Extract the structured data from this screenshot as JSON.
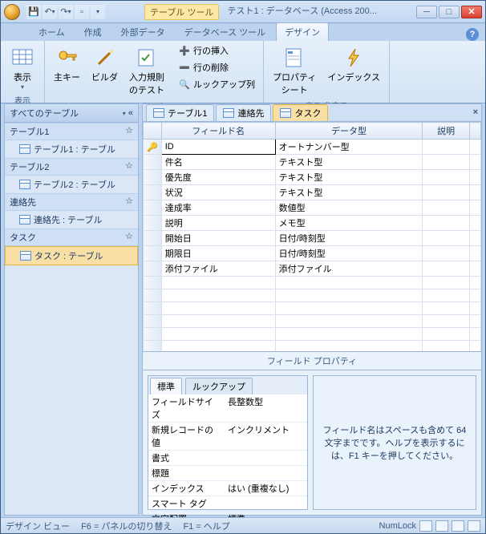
{
  "titlebar": {
    "context_tab": "テーブル ツール",
    "app_title": "テスト1 : データベース (Access 200..."
  },
  "ribbon": {
    "tabs": [
      "ホーム",
      "作成",
      "外部データ",
      "データベース ツール",
      "デザイン"
    ],
    "active_tab": 4,
    "groups": {
      "view": {
        "btn": "表示",
        "label": "表示"
      },
      "tools": {
        "pk": "主キー",
        "builder": "ビルダ",
        "validation": "入力規則\nのテスト",
        "insert_row": "行の挿入",
        "delete_row": "行の削除",
        "lookup": "ルックアップ列",
        "label": "ツール"
      },
      "showhide": {
        "prop": "プロパティ\nシート",
        "indexes": "インデックス",
        "label": "表示/非表示"
      }
    }
  },
  "nav": {
    "header": "すべてのテーブル",
    "groups": [
      {
        "name": "テーブル1",
        "items": [
          "テーブル1 : テーブル"
        ]
      },
      {
        "name": "テーブル2",
        "items": [
          "テーブル2 : テーブル"
        ]
      },
      {
        "name": "連絡先",
        "items": [
          "連絡先 : テーブル"
        ]
      },
      {
        "name": "タスク",
        "items": [
          "タスク : テーブル"
        ],
        "selected": true
      }
    ]
  },
  "doctabs": {
    "tabs": [
      "テーブル1",
      "連絡先",
      "タスク"
    ],
    "active": 2
  },
  "grid": {
    "cols": [
      "フィールド名",
      "データ型",
      "説明"
    ],
    "rows": [
      {
        "pk": true,
        "f": "ID",
        "t": "オートナンバー型",
        "active": true
      },
      {
        "f": "件名",
        "t": "テキスト型"
      },
      {
        "f": "優先度",
        "t": "テキスト型"
      },
      {
        "f": "状況",
        "t": "テキスト型"
      },
      {
        "f": "達成率",
        "t": "数値型"
      },
      {
        "f": "説明",
        "t": "メモ型"
      },
      {
        "f": "開始日",
        "t": "日付/時刻型"
      },
      {
        "f": "期限日",
        "t": "日付/時刻型"
      },
      {
        "f": "添付ファイル",
        "t": "添付ファイル"
      }
    ]
  },
  "fprops": {
    "section_label": "フィールド プロパティ",
    "tabs": [
      "標準",
      "ルックアップ"
    ],
    "rows": [
      {
        "k": "フィールドサイズ",
        "v": "長整数型"
      },
      {
        "k": "新規レコードの値",
        "v": "インクリメント"
      },
      {
        "k": "書式",
        "v": ""
      },
      {
        "k": "標題",
        "v": ""
      },
      {
        "k": "インデックス",
        "v": "はい (重複なし)"
      },
      {
        "k": "スマート タグ",
        "v": ""
      },
      {
        "k": "文字配置",
        "v": "標準"
      }
    ],
    "help": "フィールド名はスペースも含めて 64 文字までです。ヘルプを表示するには、F1 キーを押してください。"
  },
  "status": {
    "left1": "デザイン ビュー",
    "left2": "F6 = パネルの切り替え",
    "left3": "F1 = ヘルプ",
    "numlock": "NumLock"
  }
}
